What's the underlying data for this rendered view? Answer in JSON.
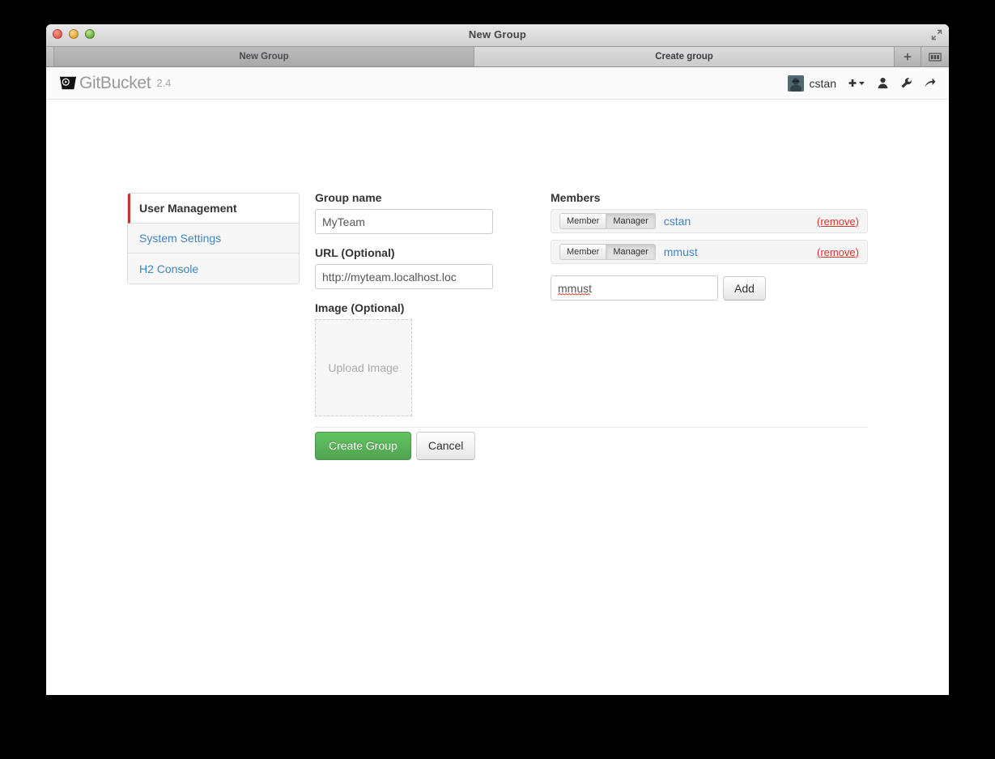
{
  "window": {
    "title": "New Group",
    "traffic_lights": [
      "close",
      "minimize",
      "zoom"
    ],
    "fullscreen_icon": "fullscreen-expand-icon",
    "tabs": [
      {
        "label": "New Group",
        "active": false
      },
      {
        "label": "Create group",
        "active": true
      }
    ],
    "tab_new_label": "+",
    "tab_overview_icon": "tab-overview-icon"
  },
  "header": {
    "brand_name": "GitBucket",
    "brand_version": "2.4",
    "logo_icon": "gitbucket-bucket-logo-icon",
    "user_name": "cstan",
    "avatar_icon": "user-avatar",
    "icons": [
      {
        "name": "plus-dropdown-icon",
        "glyph": "+"
      },
      {
        "name": "person-icon",
        "glyph": "person"
      },
      {
        "name": "wrench-icon",
        "glyph": "wrench"
      },
      {
        "name": "signout-arrow-icon",
        "glyph": "arrow"
      }
    ]
  },
  "sidebar": {
    "items": [
      {
        "label": "User Management",
        "active": true
      },
      {
        "label": "System Settings",
        "active": false
      },
      {
        "label": "H2 Console",
        "active": false
      }
    ]
  },
  "form": {
    "group_name_label": "Group name",
    "group_name_value": "MyTeam",
    "url_label": "URL (Optional)",
    "url_value": "http://myteam.localhost.loc",
    "image_label": "Image (Optional)",
    "upload_text": "Upload Image",
    "create_button": "Create Group",
    "cancel_button": "Cancel"
  },
  "members": {
    "title": "Members",
    "role_member_label": "Member",
    "role_manager_label": "Manager",
    "remove_label": "(remove)",
    "rows": [
      {
        "name": "cstan",
        "role": "Manager"
      },
      {
        "name": "mmust",
        "role": "Manager"
      }
    ],
    "add_input_value": "mmust",
    "add_button": "Add"
  },
  "colors": {
    "accent_link": "#4183c4",
    "danger": "#d9362b",
    "success": "#51a351",
    "active_marker": "#c0392b"
  }
}
